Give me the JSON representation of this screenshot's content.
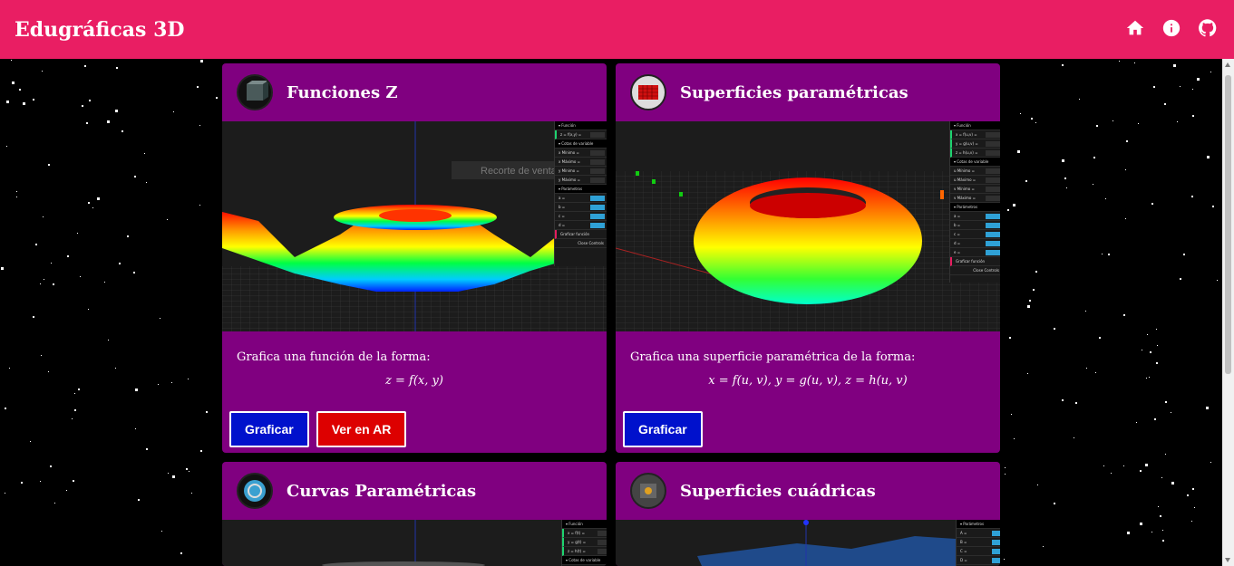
{
  "app": {
    "title": "Edugráficas 3D",
    "accent": "#e91e63",
    "card_color": "#800080"
  },
  "nav_icons": [
    "home-icon",
    "info-icon",
    "github-icon"
  ],
  "cards": [
    {
      "title": "Funciones Z",
      "description": "Grafica una función de la forma:",
      "formula": "z = f(x, y)",
      "buttons": [
        "Graficar",
        "Ver en AR"
      ],
      "overlay_text": "Recorte de venta"
    },
    {
      "title": "Superficies paramétricas",
      "description": "Grafica una superficie paramétrica de la forma:",
      "formula": "x = f(u, v), y = g(u, v), z = h(u, v)",
      "buttons": [
        "Graficar"
      ]
    },
    {
      "title": "Curvas Paramétricas"
    },
    {
      "title": "Superficies cuádricas"
    }
  ]
}
